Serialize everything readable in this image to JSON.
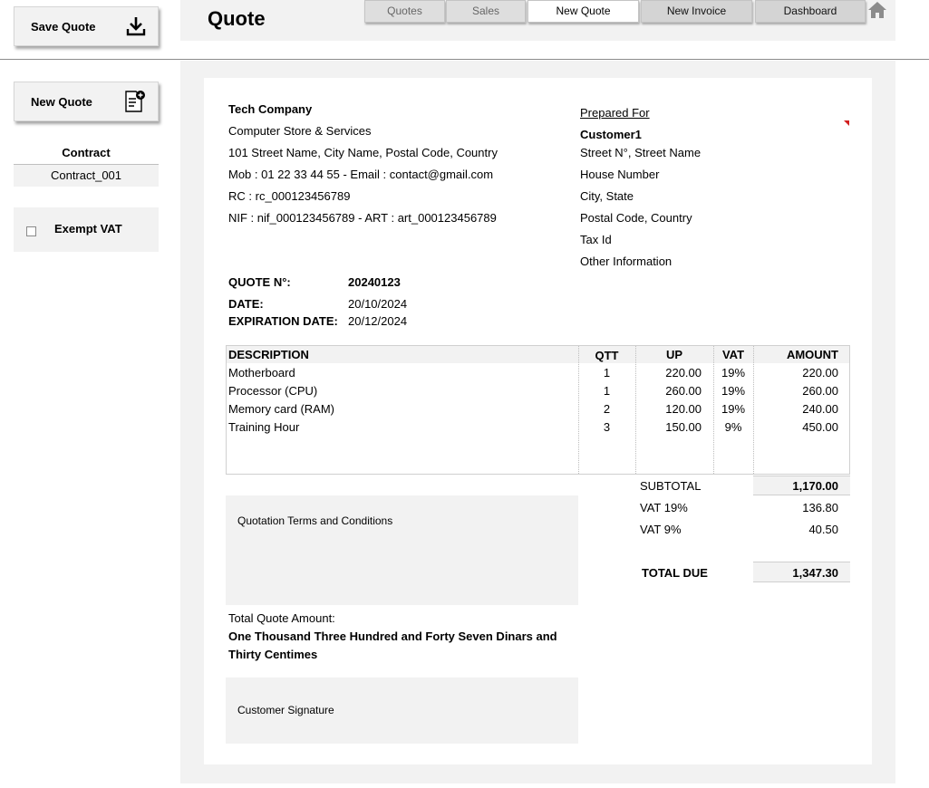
{
  "sidebar": {
    "save_label": "Save Quote",
    "new_label": "New Quote",
    "contract_label": "Contract",
    "contract_value": "Contract_001",
    "exempt_vat_label": "Exempt VAT"
  },
  "header": {
    "title": "Quote",
    "tabs": [
      {
        "label": "Quotes"
      },
      {
        "label": "Sales"
      },
      {
        "label": "New Quote"
      },
      {
        "label": "New Invoice"
      },
      {
        "label": "Dashboard"
      }
    ]
  },
  "company": {
    "name": "Tech Company",
    "tagline": "Computer Store & Services",
    "address": "101 Street Name, City Name, Postal Code, Country",
    "contact": "Mob : 01 22 33 44 55 - Email :  contact@gmail.com",
    "rc": "RC : rc_000123456789",
    "nif": "NIF : nif_000123456789 - ART : art_000123456789"
  },
  "customer": {
    "heading": "Prepared For",
    "name": "Customer1",
    "street": "Street N°, Street Name",
    "house": "House Number",
    "city": "City, State",
    "postal": "Postal Code, Country",
    "tax": "Tax Id",
    "other": "Other Information"
  },
  "quote_info": {
    "number_label": "QUOTE N°:",
    "number": "20240123",
    "date_label": "DATE:",
    "date": "20/10/2024",
    "expiration_label": "EXPIRATION DATE:",
    "expiration": "20/12/2024"
  },
  "items": {
    "headers": {
      "description": "DESCRIPTION",
      "qtt": "QTT",
      "up": "UP",
      "vat": "VAT",
      "amount": "AMOUNT"
    },
    "rows": [
      {
        "description": "Motherboard",
        "qtt": "1",
        "up": "220.00",
        "vat": "19%",
        "amount": "220.00"
      },
      {
        "description": "Processor (CPU)",
        "qtt": "1",
        "up": "260.00",
        "vat": "19%",
        "amount": "260.00"
      },
      {
        "description": "Memory card (RAM)",
        "qtt": "2",
        "up": "120.00",
        "vat": "19%",
        "amount": "240.00"
      },
      {
        "description": "Training Hour",
        "qtt": "3",
        "up": "150.00",
        "vat": "9%",
        "amount": "450.00"
      }
    ]
  },
  "totals": {
    "subtotal_label": "SUBTOTAL",
    "subtotal": "1,170.00",
    "vat19_label": "VAT 19%",
    "vat19": "136.80",
    "vat9_label": "VAT 9%",
    "vat9": "40.50",
    "total_label": "TOTAL DUE",
    "total": "1,347.30"
  },
  "terms": {
    "label": "Quotation Terms and Conditions"
  },
  "amount_words": {
    "label": "Total Quote Amount:",
    "line1": "One Thousand Three Hundred and Forty Seven Dinars and",
    "line2": "Thirty Centimes"
  },
  "signature": {
    "label": "Customer Signature"
  },
  "icons": [
    "download-icon",
    "new-document-icon",
    "home-icon",
    "checkbox-icon"
  ],
  "colors": {
    "panel": "#f2f2f2",
    "marker": "#d21f1f"
  }
}
